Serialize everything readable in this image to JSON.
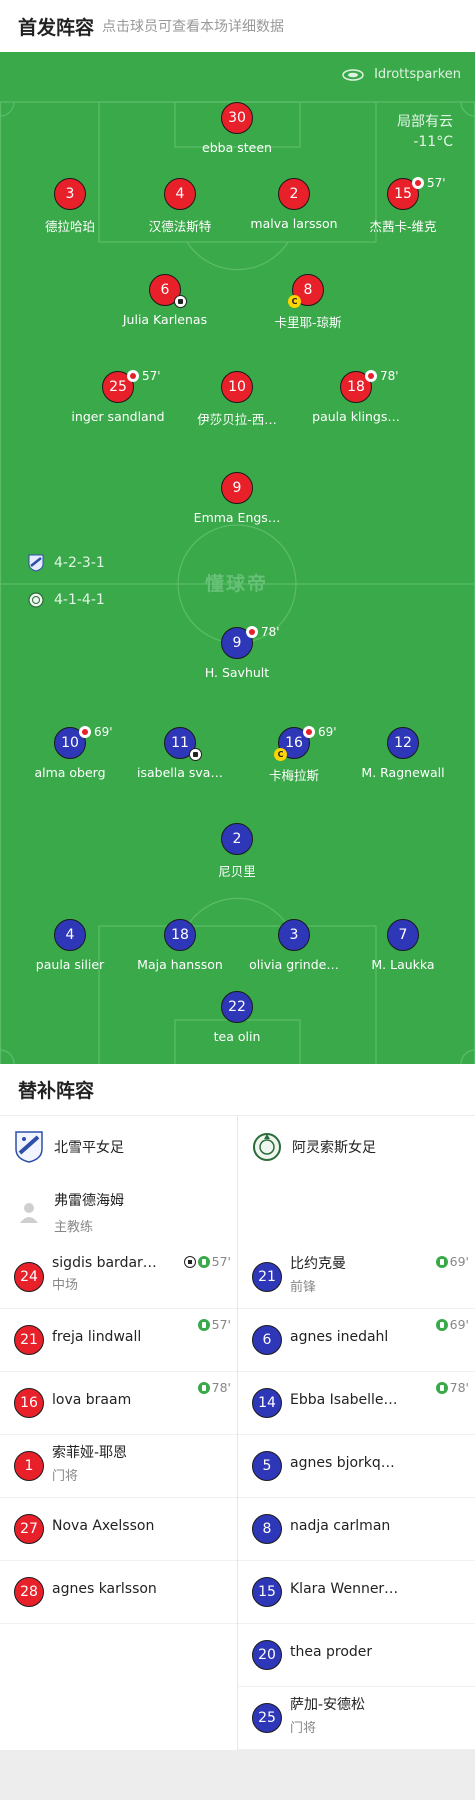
{
  "header": {
    "title": "首发阵容",
    "subtitle": "点击球员可查看本场详细数据"
  },
  "pitch": {
    "venue": "Idrottsparken",
    "weather": {
      "condition": "局部有云",
      "temp": "-11°C"
    },
    "watermark": "懂球帝",
    "home_formation": "4-2-3-1",
    "away_formation": "4-1-4-1",
    "home_players": [
      {
        "number": "30",
        "name": "ebba steen"
      },
      {
        "number": "3",
        "name": "德拉哈珀"
      },
      {
        "number": "4",
        "name": "汉德法斯特"
      },
      {
        "number": "2",
        "name": "malva larsson"
      },
      {
        "number": "15",
        "name": "杰茜卡-维克",
        "sub_off": "57'"
      },
      {
        "number": "6",
        "name": "Julia Karlenas",
        "goal": true
      },
      {
        "number": "8",
        "name": "卡里耶-琼斯",
        "captain": true
      },
      {
        "number": "25",
        "name": "inger sandland",
        "sub_off": "57'"
      },
      {
        "number": "10",
        "name": "伊莎贝拉-西…"
      },
      {
        "number": "18",
        "name": "paula klings…",
        "sub_off": "78'"
      },
      {
        "number": "9",
        "name": "Emma Engs…"
      }
    ],
    "away_players": [
      {
        "number": "9",
        "name": "H. Savhult",
        "sub_off": "78'"
      },
      {
        "number": "10",
        "name": "alma oberg",
        "sub_off": "69'"
      },
      {
        "number": "11",
        "name": "isabella sva…",
        "goal": true
      },
      {
        "number": "16",
        "name": "卡梅拉斯",
        "sub_off": "69'",
        "captain": true
      },
      {
        "number": "12",
        "name": "M. Ragnewall"
      },
      {
        "number": "2",
        "name": "尼贝里"
      },
      {
        "number": "4",
        "name": "paula silier"
      },
      {
        "number": "18",
        "name": "Maja hansson"
      },
      {
        "number": "3",
        "name": "olivia grinde…"
      },
      {
        "number": "7",
        "name": "M. Laukka"
      },
      {
        "number": "22",
        "name": "tea olin"
      }
    ],
    "badges": {
      "captain": "C"
    }
  },
  "bench": {
    "title": "替补阵容",
    "home": {
      "team": "北雪平女足",
      "coach": {
        "name": "弗雷德海姆",
        "role": "主教练"
      },
      "players": [
        {
          "number": "24",
          "name": "sigdis bardar…",
          "role": "中场",
          "sub_in": "57'",
          "goal": true
        },
        {
          "number": "21",
          "name": "freja lindwall",
          "role": "",
          "sub_in": "57'"
        },
        {
          "number": "16",
          "name": "lova braam",
          "role": "",
          "sub_in": "78'"
        },
        {
          "number": "1",
          "name": "索菲娅-耶恩",
          "role": "门将",
          "sub_in": ""
        },
        {
          "number": "27",
          "name": "Nova Axelsson",
          "role": "",
          "sub_in": ""
        },
        {
          "number": "28",
          "name": "agnes karlsson",
          "role": "",
          "sub_in": ""
        }
      ]
    },
    "away": {
      "team": "阿灵索斯女足",
      "players": [
        {
          "number": "21",
          "name": "比约克曼",
          "role": "前锋",
          "sub_in": "69'"
        },
        {
          "number": "6",
          "name": "agnes inedahl",
          "role": "",
          "sub_in": "69'"
        },
        {
          "number": "14",
          "name": "Ebba Isabelle…",
          "role": "",
          "sub_in": "78'"
        },
        {
          "number": "5",
          "name": "agnes bjorkq…",
          "role": "",
          "sub_in": ""
        },
        {
          "number": "8",
          "name": "nadja carlman",
          "role": "",
          "sub_in": ""
        },
        {
          "number": "15",
          "name": "Klara Wenner…",
          "role": "",
          "sub_in": ""
        },
        {
          "number": "20",
          "name": "thea proder",
          "role": "",
          "sub_in": ""
        },
        {
          "number": "25",
          "name": "萨加-安德松",
          "role": "门将",
          "sub_in": ""
        }
      ]
    }
  },
  "colors": {
    "pitch": "#3aa94a",
    "home": "#e8202a",
    "away": "#2e37b8",
    "captain": "#ffd400"
  }
}
